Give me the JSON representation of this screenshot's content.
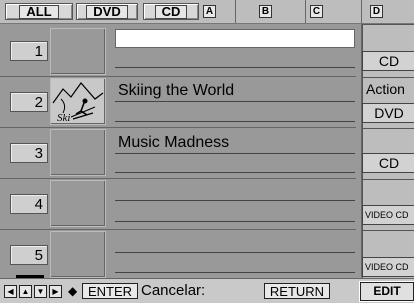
{
  "tabs": {
    "all": "ALL",
    "dvd": "DVD",
    "cd": "CD",
    "col_a": "A",
    "col_b": "B",
    "col_c": "C",
    "col_d": "D"
  },
  "rows": [
    {
      "number": "1",
      "title": "",
      "genre": "",
      "media": "CD",
      "thumbnail": null
    },
    {
      "number": "2",
      "title": "Skiing the World",
      "genre": "Action",
      "media": "DVD",
      "thumbnail": "skier-icon",
      "thumbnail_text": "Ski"
    },
    {
      "number": "3",
      "title": "Music Madness",
      "genre": "",
      "media": "CD",
      "thumbnail": null
    },
    {
      "number": "4",
      "title": "",
      "genre": "",
      "media": "VIDEO CD",
      "thumbnail": null
    },
    {
      "number": "5",
      "title": "",
      "genre": "",
      "media": "VIDEO CD",
      "thumbnail": null
    }
  ],
  "footer": {
    "arrow_arrow": "◆",
    "enter_label": "ENTER",
    "cancel_text": "Cancelar:",
    "return_label": "RETURN",
    "edit_label": "EDIT"
  }
}
